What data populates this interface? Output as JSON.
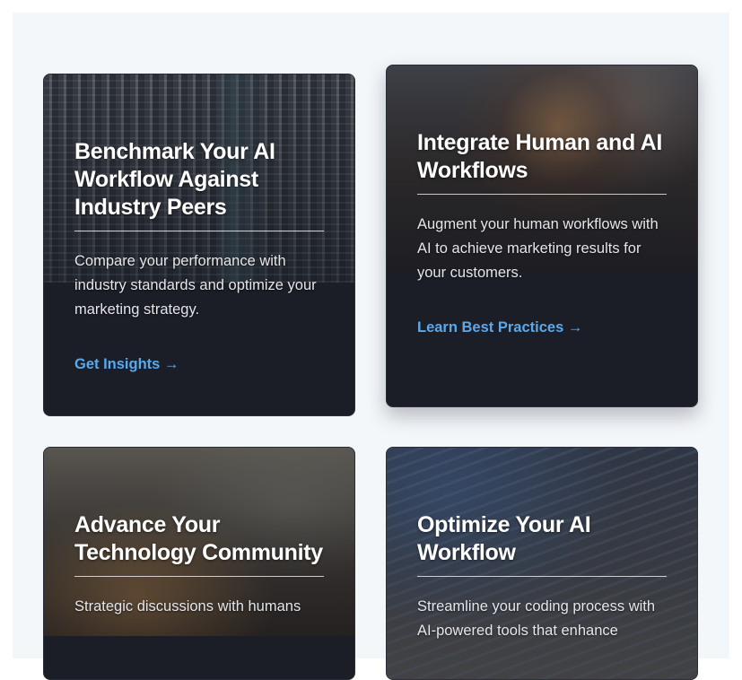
{
  "cards": [
    {
      "title": "Benchmark Your AI Workflow Against Industry Peers",
      "description": "Compare your performance with industry standards and optimize your marketing strategy.",
      "cta": "Get Insights →",
      "image": "city-skyscrapers-photo"
    },
    {
      "title": "Integrate Human and AI Workflows",
      "description": "Augment your human workflows with AI to achieve marketing results for your customers.",
      "cta": "Learn Best Practices →",
      "image": "handshake-network-photo"
    },
    {
      "title": "Advance Your Technology Community",
      "description": "Strategic discussions with humans",
      "image": "team-meeting-photo"
    },
    {
      "title": "Optimize Your AI Workflow",
      "description": "Streamline your coding process with AI-powered tools that enhance",
      "image": "laptop-code-photo"
    }
  ],
  "colors": {
    "card_background": "#1b1e27",
    "link": "#5aa9ec",
    "section_background": "#f4f7fa"
  }
}
